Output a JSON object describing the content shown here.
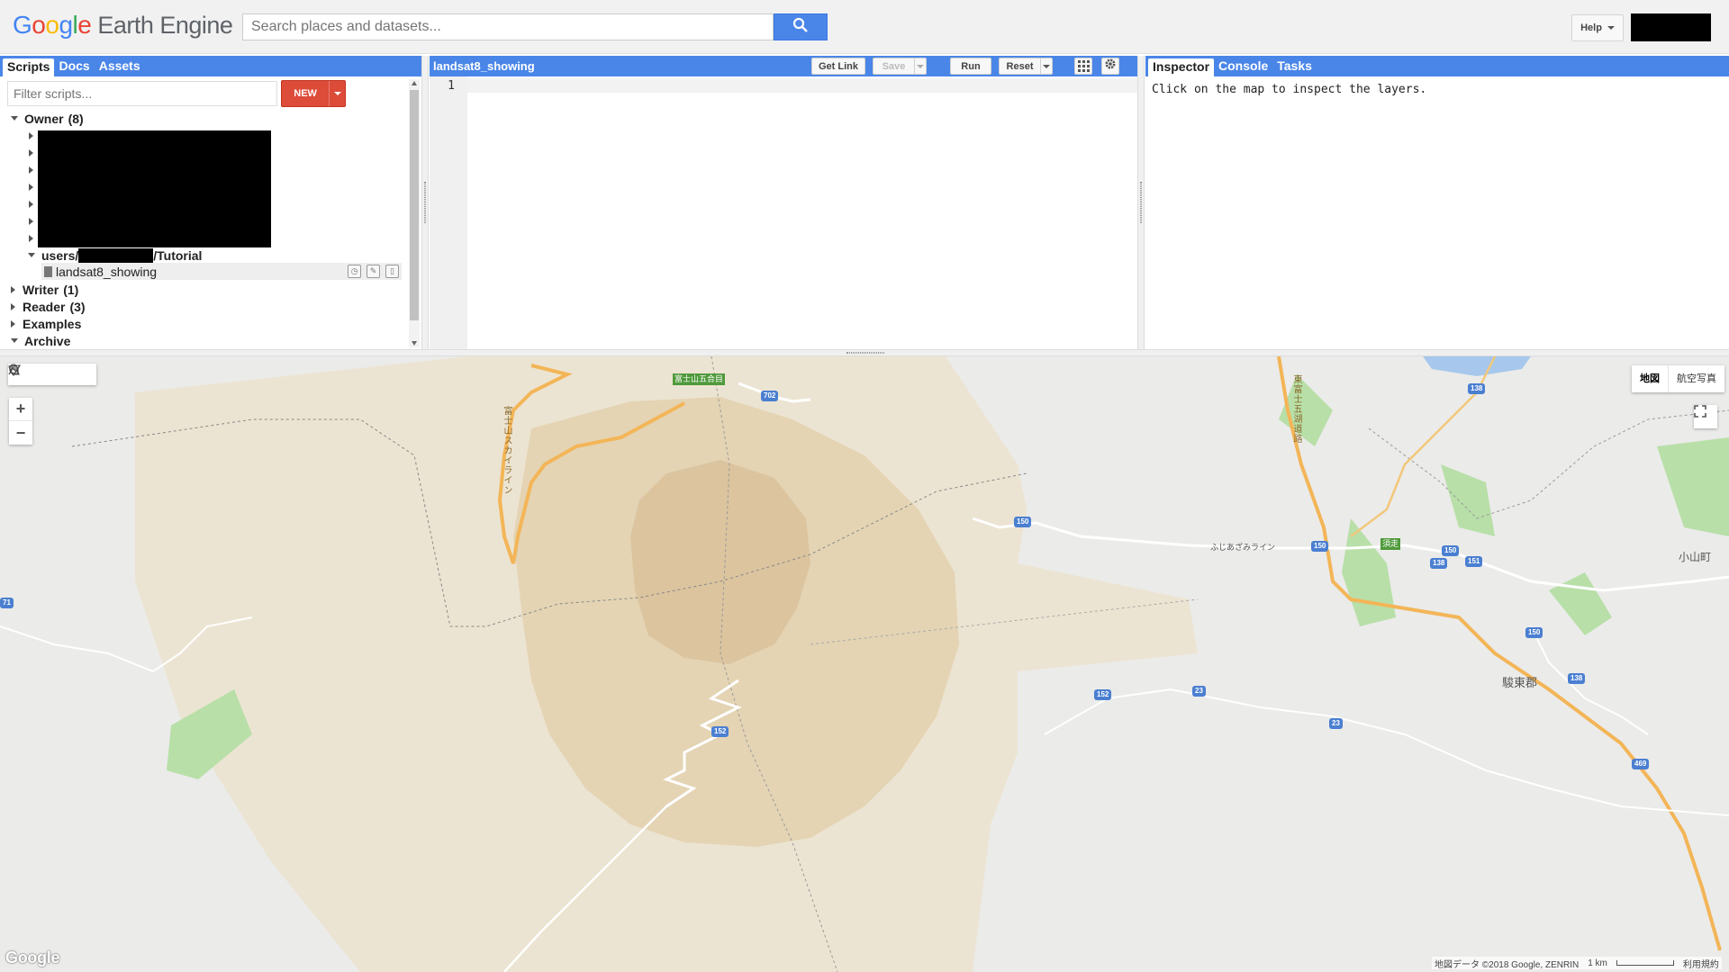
{
  "header": {
    "logo_text_rest": "Earth Engine",
    "search_placeholder": "Search places and datasets...",
    "help_label": "Help"
  },
  "left_panel": {
    "tabs": [
      {
        "label": "Scripts",
        "active": true
      },
      {
        "label": "Docs",
        "active": false
      },
      {
        "label": "Assets",
        "active": false
      }
    ],
    "filter_placeholder": "Filter scripts...",
    "new_button_label": "NEW",
    "tree": {
      "owner_label": "Owner",
      "owner_count": "(8)",
      "user_repo_prefix": "users/",
      "user_repo_suffix": "/Tutorial",
      "script_name": "landsat8_showing",
      "writer_label": "Writer",
      "writer_count": "(1)",
      "reader_label": "Reader",
      "reader_count": "(3)",
      "examples_label": "Examples",
      "archive_label": "Archive"
    }
  },
  "editor": {
    "title": "landsat8_showing",
    "get_link_label": "Get Link",
    "save_label": "Save",
    "run_label": "Run",
    "reset_label": "Reset",
    "line_numbers": [
      "1"
    ]
  },
  "right_panel": {
    "tabs": [
      {
        "label": "Inspector",
        "active": true
      },
      {
        "label": "Console",
        "active": false
      },
      {
        "label": "Tasks",
        "active": false
      }
    ],
    "inspector_message": "Click on the map to inspect the layers."
  },
  "map": {
    "maptype_options": [
      {
        "label": "地図",
        "active": true
      },
      {
        "label": "航空写真",
        "active": false
      }
    ],
    "zoom_in_label": "+",
    "zoom_out_label": "−",
    "google_mark": "Google",
    "attribution": "地図データ ©2018 Google, ZENRIN",
    "scale_label": "1 km",
    "terms": "利用規約",
    "poi_fuji": "富士山五合目",
    "poi_subashiri": "須走",
    "road_fujisan_skyline": "富士山スカイライン",
    "road_higashifuji": "東富士五湖道路",
    "road_fujiazami": "ふじあざみライン",
    "place_oyama": "小山町",
    "place_sunto": "駿東郡",
    "route_shields": [
      "138",
      "702",
      "150",
      "150",
      "150",
      "151",
      "138",
      "150",
      "152",
      "23",
      "23",
      "138",
      "152",
      "469",
      "71"
    ]
  },
  "colors": {
    "accent_blue": "#4a86e8",
    "new_red": "#dd4b39",
    "map_background": "#ebebea",
    "park_outer": "#ece4d2",
    "park_mid": "#e4d4b4",
    "park_inner": "#dbc49e"
  }
}
